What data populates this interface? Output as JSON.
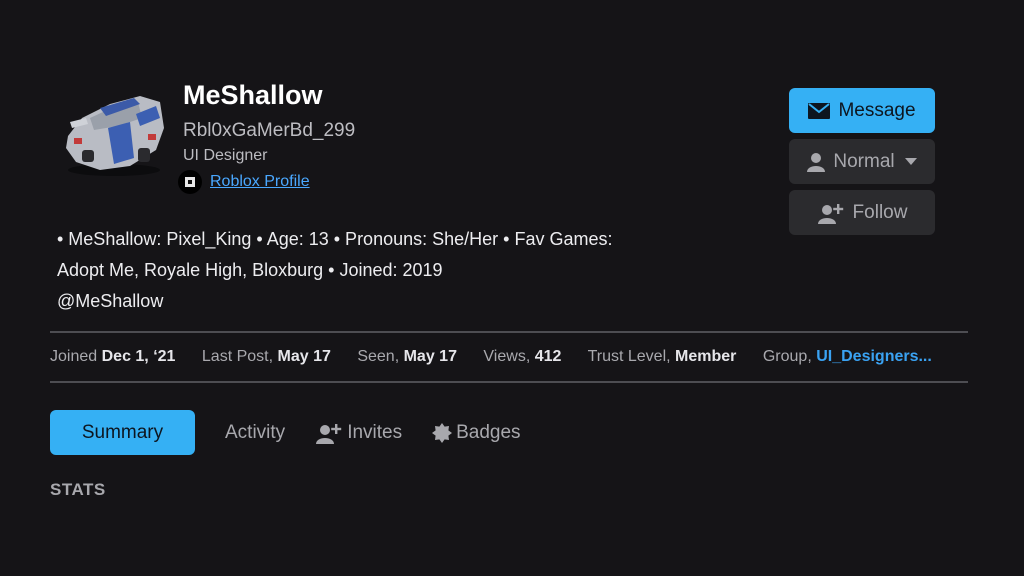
{
  "profile": {
    "name": "MeShallow",
    "username": "Rbl0xGaMerBd_299",
    "title": "UI Designer",
    "profile_link": "Roblox Profile"
  },
  "actions": {
    "message": "Message",
    "notification_level": "Normal",
    "follow": "Follow"
  },
  "bio": {
    "line1": "• MeShallow: Pixel_King • Age: 13 • Pronouns: She/Her • Fav Games:",
    "line2": "Adopt Me, Royale High, Bloxburg • Joined: 2019",
    "line3": "@MeShallow"
  },
  "meta": {
    "joined_label": "Joined",
    "joined_value": "Dec 1, ‘21",
    "last_post_label": "Last Post,",
    "last_post_value": "May 17",
    "seen_label": "Seen,",
    "seen_value": "May 17",
    "views_label": "Views,",
    "views_value": "412",
    "trust_label": "Trust Level,",
    "trust_value": "Member",
    "group_label": "Group,",
    "group_value": "UI_Designers..."
  },
  "tabs": {
    "summary": "Summary",
    "activity": "Activity",
    "invites": "Invites",
    "badges": "Badges"
  },
  "section": {
    "stats": "STATS"
  },
  "colors": {
    "accent": "#35b0f4",
    "link": "#3aa2f2",
    "background": "#151417"
  }
}
